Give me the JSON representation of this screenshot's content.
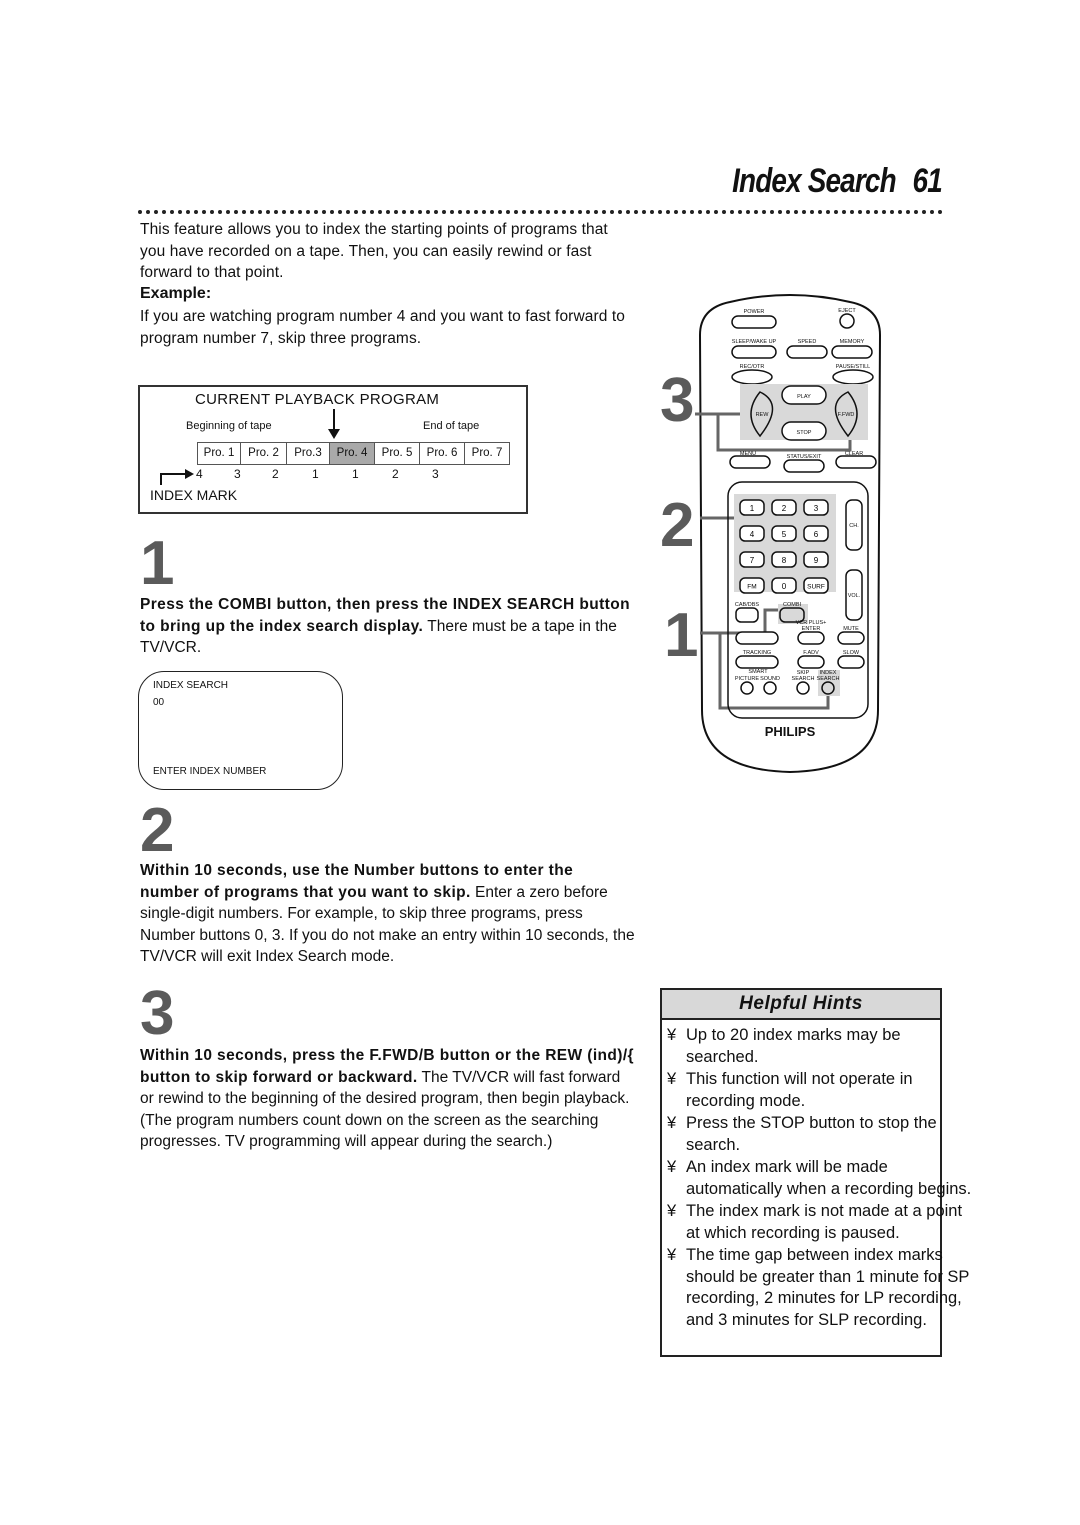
{
  "header": {
    "title": "Index Search",
    "page_number": "61"
  },
  "intro": {
    "text": "This feature allows you to index the starting points of programs that you have recorded on a tape. Then, you can easily rewind or fast forward to that point.",
    "example_label": "Example:",
    "example_text": "If you are watching program number 4 and you want to fast forward to program number 7, skip three programs."
  },
  "diagram": {
    "title": "CURRENT PLAYBACK PROGRAM",
    "beginning_label": "Beginning of tape",
    "end_label": "End of tape",
    "programs": [
      "Pro. 1",
      "Pro. 2",
      "Pro.3",
      "Pro. 4",
      "Pro. 5",
      "Pro. 6",
      "Pro. 7"
    ],
    "current_program_index": 3,
    "index_marks": [
      "4",
      "3",
      "2",
      "1",
      "1",
      "2",
      "3"
    ],
    "index_mark_label": "INDEX MARK",
    "highlight_color": "#a9a9a9"
  },
  "steps": [
    {
      "number": "1",
      "bold": "Press the COMBI button, then press the INDEX SEARCH button to bring up the index search display.",
      "normal": " There must be a tape in the TV/VCR."
    },
    {
      "number": "2",
      "bold": "Within 10 seconds, use the Number buttons to enter the number of programs that you want to skip.",
      "normal": " Enter a zero before single-digit numbers. For example, to skip three programs, press Number buttons 0, 3. If you do not make an entry within 10 seconds, the TV/VCR will exit Index Search mode."
    },
    {
      "number": "3",
      "bold": "Within 10 seconds, press the F.FWD/B button or the REW (ind)/{ button to skip forward or backward.",
      "normal": " The TV/VCR will fast forward or rewind to the beginning of the desired program, then begin playback. (The program numbers count down on the screen as the searching progresses. TV programming will appear during the search.)"
    }
  ],
  "osd": {
    "line1": "INDEX SEARCH",
    "line2": "00",
    "line3": "ENTER INDEX NUMBER"
  },
  "callouts": [
    "3",
    "2",
    "1"
  ],
  "remote": {
    "brand": "PHILIPS",
    "labels": {
      "power": "POWER",
      "eject": "EJECT",
      "sleep": "SLEEP/WAKE UP",
      "speed": "SPEED",
      "memory": "MEMORY",
      "rec": "REC/OTR",
      "pause": "PAUSE/STILL",
      "play": "PLAY",
      "rew": "REW",
      "ffwd": "F.FWD",
      "stop": "STOP",
      "menu": "MENU",
      "status": "STATUS/EXIT",
      "clear": "CLEAR",
      "ch": "CH.",
      "vol": "VOL.",
      "fm": "FM",
      "surf": "SURF",
      "cab": "CAB/DBS",
      "combi": "COMBI",
      "vcrplus": "VCR PLUS+",
      "enter": "ENTER",
      "mute": "MUTE",
      "tracking": "TRACKING",
      "fadv": "F.ADV",
      "slow": "SLOW",
      "smart": "SMART",
      "picture": "PICTURE",
      "sound": "SOUND",
      "skip": "SKIP",
      "search": "SEARCH",
      "index": "INDEX"
    },
    "number_keys": [
      "1",
      "2",
      "3",
      "4",
      "5",
      "6",
      "7",
      "8",
      "9",
      "0"
    ]
  },
  "hints": {
    "title": "Helpful Hints",
    "bullet": "¥",
    "items": [
      "Up to 20 index marks may be searched.",
      "This function will not operate in recording mode.",
      "Press the STOP button to stop the search.",
      "An index mark will be made automatically when a recording begins.",
      "The index mark is not made at a point at which recording is paused.",
      "The time gap between index marks should be greater than 1 minute for SP recording, 2 minutes for LP recording, and 3 minutes for SLP recording."
    ]
  }
}
